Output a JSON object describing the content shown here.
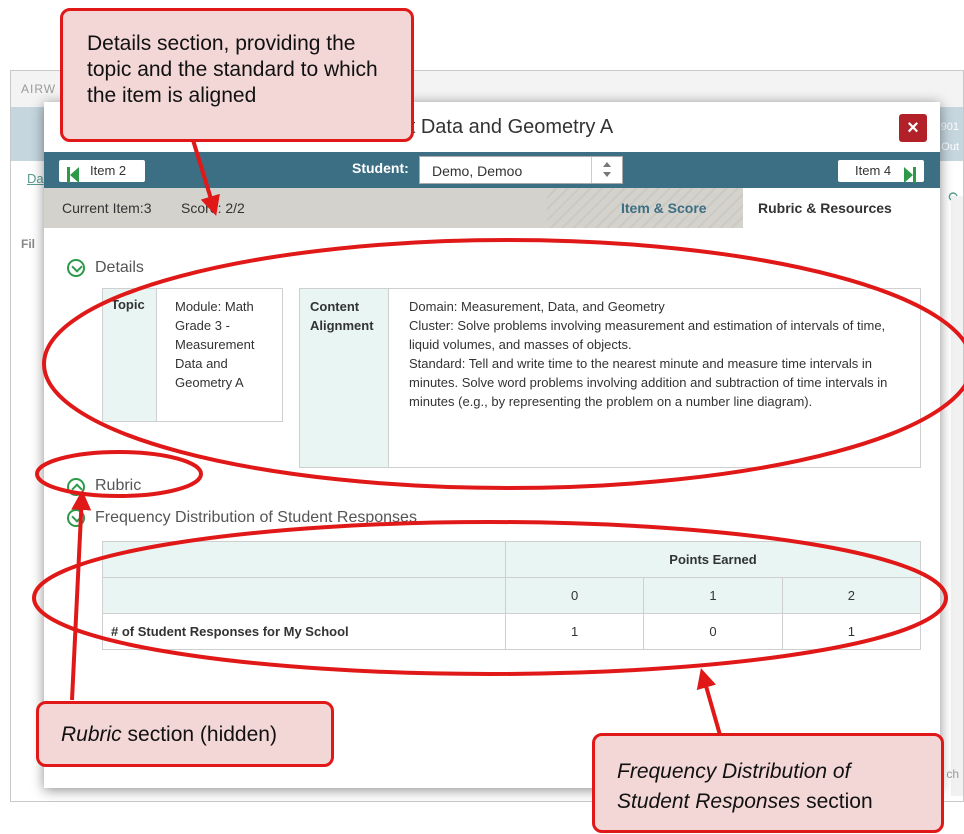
{
  "background": {
    "app_name": "AIRW",
    "banner_right_top": "901",
    "banner_right_bottom": "Out",
    "link_text": "Da",
    "filter_label": "Fil",
    "bottom_right_text": "ch"
  },
  "modal": {
    "title": "ment Data and Geometry A",
    "close_label": "×",
    "prev_item_label": "Item 2",
    "next_item_label": "Item 4",
    "student_label": "Student:",
    "student_value": "Demo, Demoo",
    "current_item": "Current Item:3",
    "score": "Score: 2/2",
    "tabs": [
      "Item & Score",
      "Rubric & Resources"
    ],
    "active_tab": "Rubric & Resources"
  },
  "details": {
    "title": "Details",
    "topic_label": "Topic",
    "topic_value": "Module: Math Grade 3 - Measurement Data and Geometry A",
    "alignment_label": "Content Alignment",
    "alignment_lines": [
      "Domain: Measurement, Data, and Geometry",
      "Cluster: Solve problems involving measurement and estimation of intervals of time, liquid volumes, and masses of objects.",
      "Standard: Tell and write time to the nearest minute and measure time intervals in minutes. Solve word problems involving addition and subtraction of time intervals in minutes (e.g., by representing the problem on a number line diagram)."
    ]
  },
  "rubric": {
    "title": "Rubric"
  },
  "frequency": {
    "title": "Frequency Distribution of Student Responses",
    "points_header": "Points Earned",
    "points": [
      "0",
      "1",
      "2"
    ],
    "row_label": "# of Student Responses for My School",
    "row_values": [
      "1",
      "0",
      "1"
    ]
  },
  "annotations": {
    "details_callout": "Details section, providing the topic and the standard to which the item is aligned",
    "rubric_callout_em": "Rubric",
    "rubric_callout_rest": " section (hidden)",
    "frequency_callout_em": "Frequency Distribution of Student Responses",
    "frequency_callout_rest": " section",
    "accent_color": "#e01818"
  }
}
